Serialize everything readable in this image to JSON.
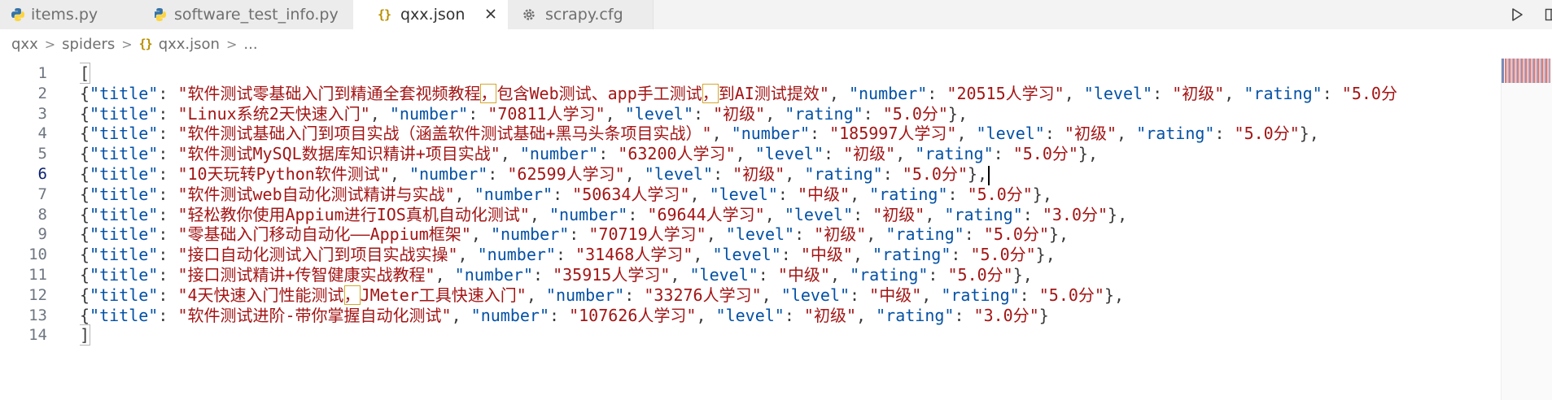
{
  "tabs": [
    {
      "label": "items.py",
      "icon": "python-icon"
    },
    {
      "label": "software_test_info.py",
      "icon": "python-icon"
    },
    {
      "label": "qxx.json",
      "icon": "json-icon",
      "active": true,
      "close": "✕"
    },
    {
      "label": "scrapy.cfg",
      "icon": "gear-icon"
    }
  ],
  "title_actions": {
    "run_icon": "run-icon",
    "split_icon": "split-editor-icon"
  },
  "breadcrumb": {
    "items": [
      "qxx",
      "spiders",
      "qxx.json",
      "..."
    ],
    "json_icon": "{}",
    "separator": ">"
  },
  "editor": {
    "current_line": 6,
    "lines": [
      {
        "n": "1",
        "open": "["
      },
      {
        "n": "2",
        "title": "软件测试零基础入门到精通全套视频教程，包含Web测试、app手工测试，到AI测试提效",
        "number": "20515人学习",
        "level": "初级",
        "rating": "5.0分",
        "truncated": "\"5.0分"
      },
      {
        "n": "3",
        "title": "Linux系统2天快速入门",
        "number": "70811人学习",
        "level": "初级",
        "rating": "5.0分"
      },
      {
        "n": "4",
        "title": "软件测试基础入门到项目实战（涵盖软件测试基础+黑马头条项目实战）",
        "number": "185997人学习",
        "level": "初级",
        "rating": "5.0分"
      },
      {
        "n": "5",
        "title": "软件测试MySQL数据库知识精讲+项目实战",
        "number": "63200人学习",
        "level": "初级",
        "rating": "5.0分"
      },
      {
        "n": "6",
        "title": "10天玩转Python软件测试",
        "number": "62599人学习",
        "level": "初级",
        "rating": "5.0分"
      },
      {
        "n": "7",
        "title": "软件测试web自动化测试精讲与实战",
        "number": "50634人学习",
        "level": "中级",
        "rating": "5.0分"
      },
      {
        "n": "8",
        "title": "轻松教你使用Appium进行IOS真机自动化测试",
        "number": "69644人学习",
        "level": "初级",
        "rating": "3.0分"
      },
      {
        "n": "9",
        "title": "零基础入门移动自动化——Appium框架",
        "number": "70719人学习",
        "level": "初级",
        "rating": "5.0分"
      },
      {
        "n": "10",
        "title": "接口自动化测试入门到项目实战实操",
        "number": "31468人学习",
        "level": "中级",
        "rating": "5.0分"
      },
      {
        "n": "11",
        "title": "接口测试精讲+传智健康实战教程",
        "number": "35915人学习",
        "level": "中级",
        "rating": "5.0分"
      },
      {
        "n": "12",
        "title": "4天快速入门性能测试，JMeter工具快速入门",
        "number": "33276人学习",
        "level": "中级",
        "rating": "5.0分"
      },
      {
        "n": "13",
        "title": "软件测试进阶-带你掌握自动化测试",
        "number": "107626人学习",
        "level": "初级",
        "rating": "3.0分",
        "last": true
      },
      {
        "n": "14",
        "close": "]"
      }
    ]
  },
  "colors": {
    "key": "#0451a5",
    "string": "#a31515",
    "punctuation": "#3b3b3b",
    "line_number": "#6e7681",
    "json_icon": "#b88f00",
    "python_icon_blue": "#3572a5",
    "python_icon_yellow": "#ffd43b"
  }
}
